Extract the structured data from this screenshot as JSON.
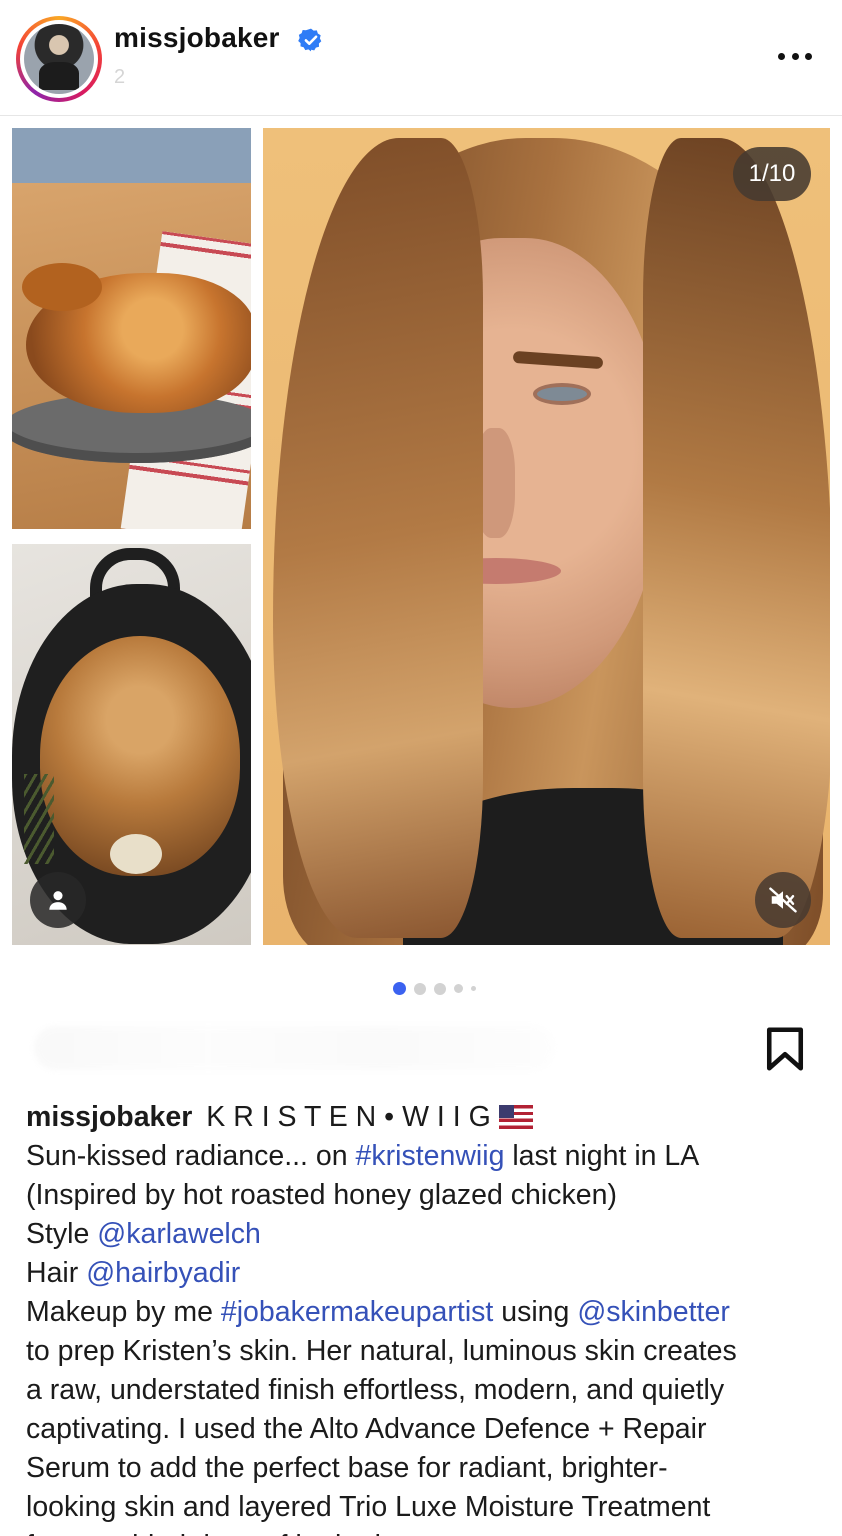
{
  "header": {
    "username": "missjobaker",
    "subtime": "2",
    "verified": true
  },
  "media": {
    "counter": "1/10",
    "left_top_image": "roast-chicken-on-board",
    "left_bottom_image": "roast-chicken-in-skillet",
    "main_image": "portrait-woman-long-hair"
  },
  "carousel": {
    "dots": 5,
    "active_index": 0
  },
  "caption": {
    "username": "missjobaker",
    "title": "K R I S T E N • W I I G",
    "line1_a": "Sun-kissed radiance... on ",
    "line1_tag": "#kristenwiig",
    "line1_b": " last night in LA",
    "line2": "(Inspired by hot roasted honey glazed chicken)",
    "line3_a": "Style ",
    "line3_tag": "@karlawelch",
    "line4_a": "Hair ",
    "line4_tag": "@hairbyadir",
    "line5_a": "Makeup by me ",
    "line5_tag1": "#jobakermakeupartist",
    "line5_b": " using ",
    "line5_tag2": "@skinbetter",
    "line6": "to prep Kristen’s skin. Her natural, luminous skin creates",
    "line7": "a raw, understated finish effortless, modern, and quietly",
    "line8": "captivating. I used the Alto Advance Defence + Repair",
    "line9": "Serum to add the perfect base for radiant, brighter-",
    "line10": "looking skin and layered Trio Luxe Moisture Treatment",
    "line11": "for an added dose of hydration."
  },
  "colors": {
    "link": "#3551b8",
    "active_dot": "#3b62f0",
    "verified": "#2f7cf6"
  }
}
